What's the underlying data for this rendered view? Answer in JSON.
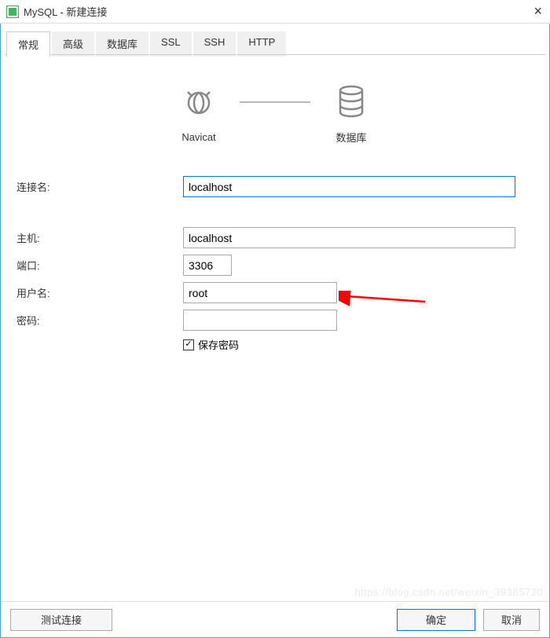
{
  "window": {
    "title": "MySQL - 新建连接"
  },
  "tabs": {
    "general": "常规",
    "advanced": "高级",
    "database": "数据库",
    "ssl": "SSL",
    "ssh": "SSH",
    "http": "HTTP"
  },
  "diagram": {
    "navicat": "Navicat",
    "database": "数据库"
  },
  "form": {
    "conn_name_label": "连接名:",
    "conn_name_value": "localhost",
    "host_label": "主机:",
    "host_value": "localhost",
    "port_label": "端口:",
    "port_value": "3306",
    "user_label": "用户名:",
    "user_value": "root",
    "password_label": "密码:",
    "password_value": "",
    "save_password_label": "保存密码",
    "save_password_checked": true
  },
  "buttons": {
    "test": "测试连接",
    "ok": "确定",
    "cancel": "取消"
  }
}
